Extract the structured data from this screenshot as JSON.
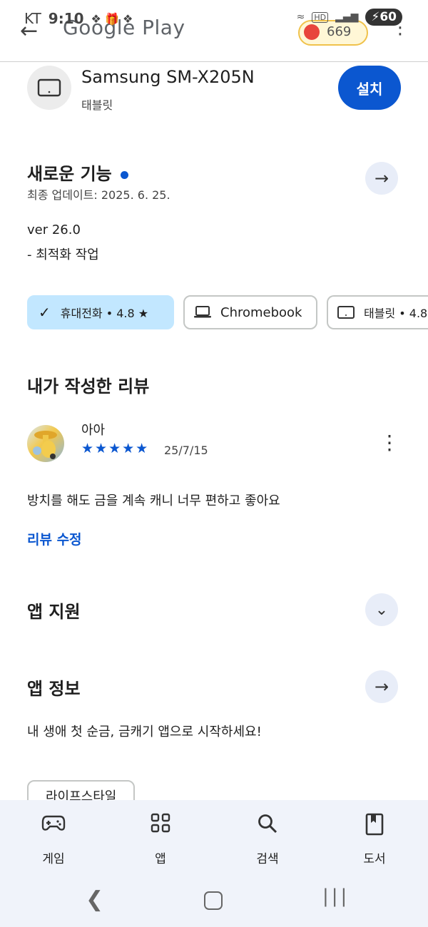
{
  "status": {
    "carrier": "KT",
    "time": "9:10",
    "battery": "60",
    "hd": "HD"
  },
  "appbar": {
    "title": "Google Play",
    "points": "669"
  },
  "device": {
    "name": "Samsung SM-X205N",
    "type": "태블릿",
    "install_label": "설치"
  },
  "whats_new": {
    "title": "새로운 기능",
    "updated": "최종 업데이트: 2025. 6. 25.",
    "version": "ver 26.0",
    "note": "- 최적화 작업"
  },
  "chips": [
    {
      "label": "휴대전화 • 4.8 ★",
      "selected": true
    },
    {
      "label": "Chromebook",
      "selected": false
    },
    {
      "label": "태블릿 • 4.8",
      "selected": false
    }
  ],
  "my_review": {
    "title": "내가 작성한 리뷰",
    "author": "아아",
    "stars": "★★★★★",
    "rating": 5,
    "date": "25/7/15",
    "text": "방치를 해도 금을 계속 캐니 너무 편하고 좋아요",
    "edit_label": "리뷰 수정"
  },
  "app_support": {
    "title": "앱 지원"
  },
  "app_info": {
    "title": "앱 정보",
    "description": "내 생애 첫 순금, 금캐기 앱으로 시작하세요!",
    "tag": "라이프스타일"
  },
  "bottom_nav": [
    {
      "label": "게임",
      "icon": "gamepad-icon"
    },
    {
      "label": "앱",
      "icon": "apps-grid-icon"
    },
    {
      "label": "검색",
      "icon": "search-icon"
    },
    {
      "label": "도서",
      "icon": "book-icon"
    }
  ]
}
